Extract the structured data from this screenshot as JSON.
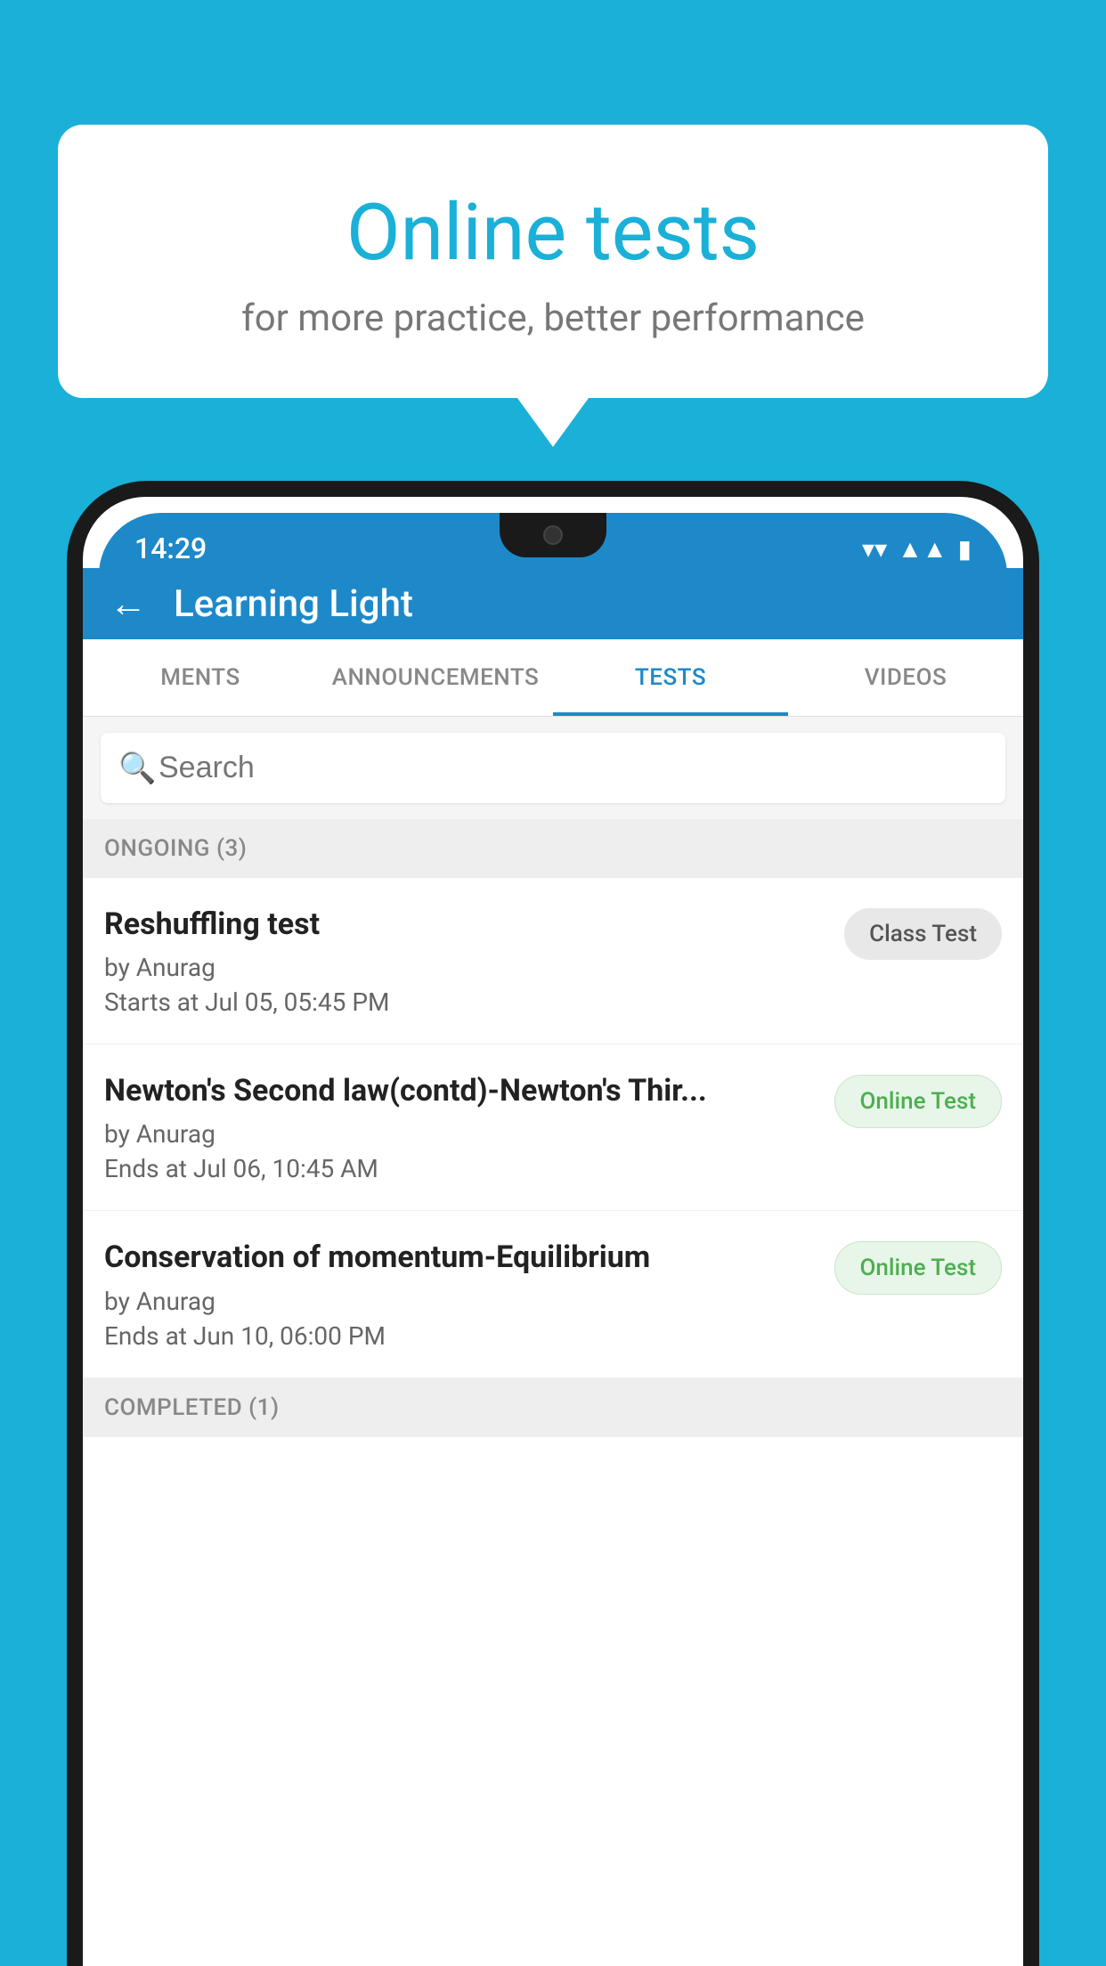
{
  "background_color": "#1ab0d8",
  "speech_bubble": {
    "title": "Online tests",
    "subtitle": "for more practice, better performance"
  },
  "phone": {
    "status_bar": {
      "time": "14:29",
      "icons": [
        "wifi",
        "signal",
        "battery"
      ]
    },
    "app_bar": {
      "title": "Learning Light",
      "back_label": "←"
    },
    "tabs": [
      {
        "label": "MENTS",
        "active": false
      },
      {
        "label": "ANNOUNCEMENTS",
        "active": false
      },
      {
        "label": "TESTS",
        "active": true
      },
      {
        "label": "VIDEOS",
        "active": false
      }
    ],
    "search": {
      "placeholder": "Search"
    },
    "sections": [
      {
        "header": "ONGOING (3)",
        "tests": [
          {
            "name": "Reshuffling test",
            "author": "by Anurag",
            "time_label": "Starts at",
            "time": "Jul 05, 05:45 PM",
            "badge": "Class Test",
            "badge_type": "class"
          },
          {
            "name": "Newton's Second law(contd)-Newton's Thir...",
            "author": "by Anurag",
            "time_label": "Ends at",
            "time": "Jul 06, 10:45 AM",
            "badge": "Online Test",
            "badge_type": "online"
          },
          {
            "name": "Conservation of momentum-Equilibrium",
            "author": "by Anurag",
            "time_label": "Ends at",
            "time": "Jun 10, 06:00 PM",
            "badge": "Online Test",
            "badge_type": "online"
          }
        ]
      },
      {
        "header": "COMPLETED (1)",
        "tests": []
      }
    ]
  }
}
